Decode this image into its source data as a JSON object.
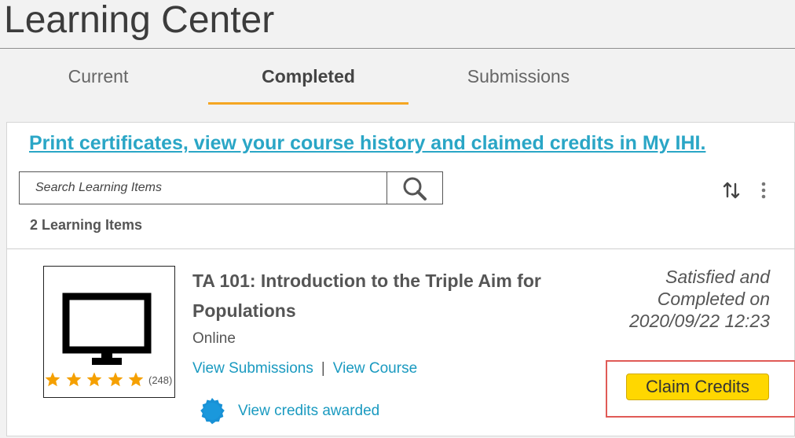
{
  "page": {
    "title": "Learning Center"
  },
  "tabs": [
    {
      "label": "Current",
      "active": false
    },
    {
      "label": "Completed",
      "active": true
    },
    {
      "label": "Submissions",
      "active": false
    }
  ],
  "banner_link": "Print certificates, view your course history and claimed credits in My IHI.",
  "search": {
    "placeholder": "Search Learning Items",
    "value": ""
  },
  "toolbar": {
    "sort_icon": "sort-arrows-icon",
    "more_icon": "more-vertical-icon"
  },
  "results": {
    "count_label": "2 Learning Items"
  },
  "item": {
    "thumbnail_icon": "monitor-icon",
    "rating": {
      "stars": 5,
      "max": 5,
      "count_label": "(248)"
    },
    "title": "TA 101: Introduction to the Triple Aim for Populations",
    "type": "Online",
    "links": {
      "submissions": "View Submissions",
      "separator": "|",
      "course": "View Course"
    },
    "credits_link": "View credits awarded",
    "status": {
      "line1": "Satisfied and",
      "line2": "Completed on",
      "line3": "2020/09/22 12:23"
    },
    "claim_button": "Claim Credits"
  },
  "colors": {
    "accent_tab": "#f5a623",
    "link": "#1a9ac0",
    "banner_link": "#2aa6c6",
    "star": "#f5a000",
    "claim_button": "#ffd700",
    "highlight": "#e05a56"
  }
}
